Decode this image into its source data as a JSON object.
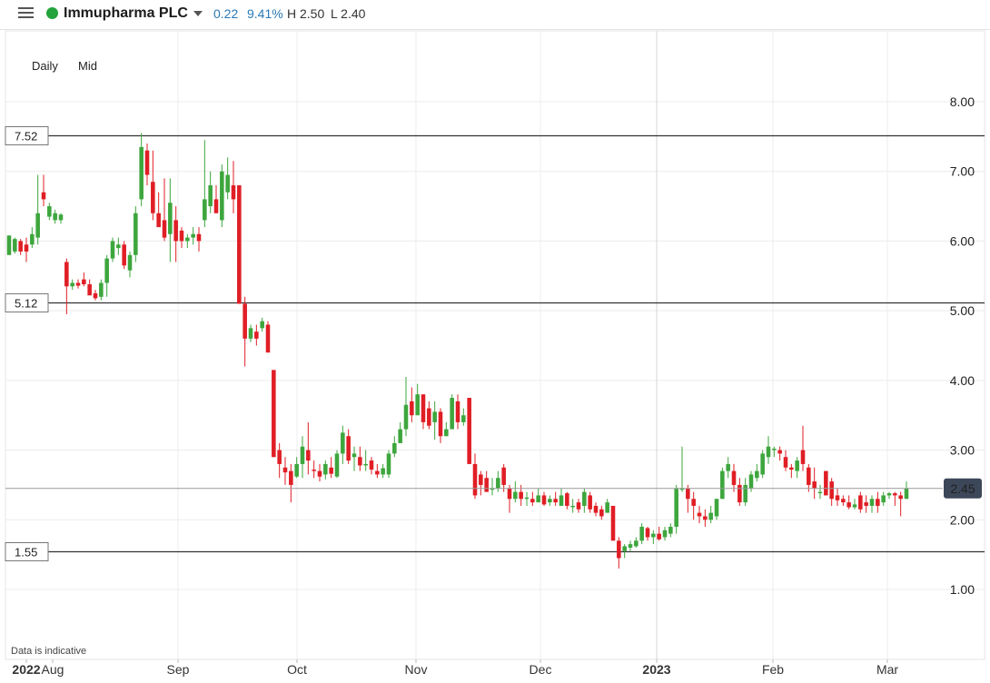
{
  "header": {
    "instrument": "Immupharma PLC",
    "change": "0.22",
    "change_pct": "9.41%",
    "high": "H 2.50",
    "low": "L 2.40",
    "status_color": "#22a33b"
  },
  "controls": {
    "interval": "Daily",
    "price_type": "Mid"
  },
  "note": "Data is indicative",
  "colors": {
    "up": "#3da63d",
    "down": "#e01e25",
    "grid": "#ececec",
    "line": "#333333"
  },
  "chart_data": {
    "type": "candlestick",
    "ylim": [
      0.5,
      8.5
    ],
    "y_ticks": [
      "8.00",
      "7.00",
      "6.00",
      "5.00",
      "4.00",
      "3.00",
      "2.00",
      "1.00"
    ],
    "x_ticks": [
      "2022",
      "Aug",
      "Sep",
      "Oct",
      "Nov",
      "Dec",
      "2023",
      "Feb",
      "Mar"
    ],
    "current_price": "2.45",
    "horizontal_lines": [
      {
        "value": 7.52,
        "label": "7.52"
      },
      {
        "value": 5.12,
        "label": "5.12"
      },
      {
        "value": 1.55,
        "label": "1.55"
      }
    ],
    "candles": [
      [
        6.08,
        5.8,
        5.8,
        6.08
      ],
      [
        6.05,
        5.82,
        5.85,
        6.03
      ],
      [
        6.03,
        5.8,
        6.0,
        5.85
      ],
      [
        6.05,
        5.7,
        5.95,
        5.85
      ],
      [
        6.2,
        5.9,
        5.95,
        6.1
      ],
      [
        6.95,
        5.95,
        6.05,
        6.4
      ],
      [
        6.95,
        6.5,
        6.7,
        6.6
      ],
      [
        6.55,
        6.3,
        6.35,
        6.5
      ],
      [
        6.45,
        6.25,
        6.3,
        6.4
      ],
      [
        6.4,
        6.25,
        6.3,
        6.38
      ],
      [
        5.75,
        4.95,
        5.7,
        5.35
      ],
      [
        5.45,
        5.3,
        5.35,
        5.4
      ],
      [
        5.45,
        5.32,
        5.4,
        5.36
      ],
      [
        5.55,
        5.35,
        5.45,
        5.38
      ],
      [
        5.45,
        5.25,
        5.38,
        5.22
      ],
      [
        5.3,
        5.15,
        5.25,
        5.18
      ],
      [
        5.45,
        5.15,
        5.2,
        5.4
      ],
      [
        5.8,
        5.2,
        5.4,
        5.75
      ],
      [
        6.05,
        5.7,
        5.75,
        6.0
      ],
      [
        6.05,
        5.8,
        5.9,
        5.95
      ],
      [
        6.0,
        5.6,
        5.95,
        5.65
      ],
      [
        5.85,
        5.48,
        5.58,
        5.8
      ],
      [
        6.5,
        5.7,
        5.8,
        6.4
      ],
      [
        7.55,
        6.5,
        6.6,
        7.35
      ],
      [
        7.4,
        6.8,
        7.3,
        6.95
      ],
      [
        7.3,
        6.3,
        6.85,
        6.4
      ],
      [
        6.7,
        6.2,
        6.4,
        6.2
      ],
      [
        6.9,
        6.0,
        6.3,
        6.05
      ],
      [
        6.9,
        5.7,
        6.1,
        6.55
      ],
      [
        6.5,
        5.7,
        6.3,
        6.0
      ],
      [
        6.2,
        5.9,
        6.15,
        6.0
      ],
      [
        6.1,
        5.9,
        6.0,
        6.05
      ],
      [
        6.2,
        5.95,
        6.05,
        6.1
      ],
      [
        6.2,
        5.85,
        6.1,
        6.0
      ],
      [
        7.45,
        6.2,
        6.3,
        6.6
      ],
      [
        7.0,
        6.4,
        6.5,
        6.8
      ],
      [
        6.8,
        6.4,
        6.6,
        6.4
      ],
      [
        7.1,
        6.2,
        6.3,
        7.0
      ],
      [
        7.2,
        6.6,
        6.7,
        6.95
      ],
      [
        7.15,
        6.4,
        6.8,
        6.6
      ],
      [
        6.8,
        5.1,
        6.8,
        5.1
      ],
      [
        5.2,
        4.2,
        5.1,
        4.6
      ],
      [
        4.8,
        4.55,
        4.6,
        4.75
      ],
      [
        4.8,
        4.5,
        4.7,
        4.6
      ],
      [
        4.9,
        4.7,
        4.75,
        4.85
      ],
      [
        4.85,
        4.4,
        4.8,
        4.4
      ],
      [
        4.15,
        2.9,
        4.15,
        2.9
      ],
      [
        3.1,
        2.6,
        3.0,
        2.8
      ],
      [
        2.9,
        2.5,
        2.75,
        2.68
      ],
      [
        2.8,
        2.25,
        2.7,
        2.5
      ],
      [
        2.9,
        2.6,
        2.62,
        2.8
      ],
      [
        3.2,
        2.6,
        2.8,
        3.05
      ],
      [
        3.4,
        2.65,
        3.0,
        2.85
      ],
      [
        2.85,
        2.6,
        2.72,
        2.7
      ],
      [
        2.8,
        2.55,
        2.7,
        2.62
      ],
      [
        2.85,
        2.58,
        2.65,
        2.8
      ],
      [
        2.9,
        2.6,
        2.75,
        2.66
      ],
      [
        3.0,
        2.6,
        2.62,
        2.95
      ],
      [
        3.35,
        2.8,
        2.95,
        3.25
      ],
      [
        3.3,
        2.8,
        3.2,
        2.85
      ],
      [
        3.05,
        2.7,
        2.9,
        2.95
      ],
      [
        3.05,
        2.7,
        2.9,
        2.78
      ],
      [
        3.0,
        2.7,
        2.78,
        2.8
      ],
      [
        2.9,
        2.65,
        2.85,
        2.72
      ],
      [
        2.8,
        2.6,
        2.7,
        2.65
      ],
      [
        2.8,
        2.6,
        2.65,
        2.74
      ],
      [
        3.0,
        2.6,
        2.65,
        2.95
      ],
      [
        3.2,
        2.9,
        2.95,
        3.1
      ],
      [
        3.4,
        3.1,
        3.1,
        3.3
      ],
      [
        4.05,
        3.2,
        3.3,
        3.65
      ],
      [
        3.9,
        3.4,
        3.7,
        3.5
      ],
      [
        3.95,
        3.5,
        3.5,
        3.8
      ],
      [
        3.8,
        3.3,
        3.8,
        3.4
      ],
      [
        3.7,
        3.3,
        3.6,
        3.35
      ],
      [
        3.7,
        3.15,
        3.4,
        3.55
      ],
      [
        3.6,
        3.1,
        3.55,
        3.2
      ],
      [
        3.4,
        3.2,
        3.2,
        3.3
      ],
      [
        3.8,
        3.3,
        3.3,
        3.75
      ],
      [
        3.8,
        3.3,
        3.7,
        3.4
      ],
      [
        3.6,
        3.35,
        3.4,
        3.5
      ],
      [
        3.75,
        2.8,
        3.75,
        2.8
      ],
      [
        2.95,
        2.3,
        2.8,
        2.35
      ],
      [
        2.7,
        2.35,
        2.65,
        2.5
      ],
      [
        2.7,
        2.4,
        2.6,
        2.4
      ],
      [
        2.6,
        2.35,
        2.45,
        2.45
      ],
      [
        2.7,
        2.4,
        2.45,
        2.6
      ],
      [
        2.8,
        2.4,
        2.75,
        2.5
      ],
      [
        2.5,
        2.1,
        2.45,
        2.3
      ],
      [
        2.55,
        2.25,
        2.3,
        2.4
      ],
      [
        2.5,
        2.2,
        2.4,
        2.3
      ],
      [
        2.4,
        2.2,
        2.3,
        2.32
      ],
      [
        2.4,
        2.2,
        2.3,
        2.25
      ],
      [
        2.45,
        2.25,
        2.25,
        2.35
      ],
      [
        2.4,
        2.2,
        2.35,
        2.22
      ],
      [
        2.35,
        2.2,
        2.25,
        2.3
      ],
      [
        2.4,
        2.2,
        2.3,
        2.25
      ],
      [
        2.45,
        2.2,
        2.2,
        2.35
      ],
      [
        2.4,
        2.15,
        2.38,
        2.2
      ],
      [
        2.3,
        2.1,
        2.2,
        2.2
      ],
      [
        2.3,
        2.1,
        2.25,
        2.15
      ],
      [
        2.45,
        2.1,
        2.2,
        2.4
      ],
      [
        2.4,
        2.1,
        2.35,
        2.15
      ],
      [
        2.25,
        2.05,
        2.2,
        2.1
      ],
      [
        2.2,
        2.0,
        2.15,
        2.05
      ],
      [
        2.3,
        2.1,
        2.1,
        2.25
      ],
      [
        2.2,
        1.7,
        2.2,
        1.7
      ],
      [
        1.75,
        1.3,
        1.7,
        1.45
      ],
      [
        1.65,
        1.45,
        1.55,
        1.62
      ],
      [
        1.7,
        1.55,
        1.6,
        1.65
      ],
      [
        1.75,
        1.6,
        1.62,
        1.7
      ],
      [
        1.95,
        1.65,
        1.7,
        1.9
      ],
      [
        1.9,
        1.7,
        1.88,
        1.75
      ],
      [
        1.85,
        1.65,
        1.75,
        1.8
      ],
      [
        1.9,
        1.7,
        1.8,
        1.72
      ],
      [
        1.9,
        1.7,
        1.75,
        1.85
      ],
      [
        1.95,
        1.75,
        1.8,
        1.9
      ],
      [
        2.5,
        1.8,
        1.9,
        2.45
      ],
      [
        3.05,
        2.4,
        2.45,
        2.45
      ],
      [
        2.5,
        2.1,
        2.45,
        2.3
      ],
      [
        2.4,
        2.0,
        2.3,
        2.2
      ],
      [
        2.2,
        1.95,
        2.1,
        2.05
      ],
      [
        2.15,
        1.9,
        2.05,
        2.0
      ],
      [
        2.2,
        1.95,
        2.0,
        2.1
      ],
      [
        2.3,
        2.0,
        2.05,
        2.3
      ],
      [
        2.75,
        2.3,
        2.3,
        2.7
      ],
      [
        2.9,
        2.6,
        2.7,
        2.8
      ],
      [
        2.8,
        2.4,
        2.7,
        2.5
      ],
      [
        2.6,
        2.2,
        2.5,
        2.25
      ],
      [
        2.6,
        2.2,
        2.25,
        2.5
      ],
      [
        2.7,
        2.4,
        2.45,
        2.65
      ],
      [
        2.8,
        2.55,
        2.6,
        2.7
      ],
      [
        3.0,
        2.6,
        2.65,
        2.95
      ],
      [
        3.2,
        2.8,
        2.9,
        3.05
      ],
      [
        3.05,
        2.9,
        3.0,
        3.02
      ],
      [
        3.05,
        2.85,
        3.0,
        2.95
      ],
      [
        3.0,
        2.7,
        2.9,
        2.75
      ],
      [
        2.8,
        2.6,
        2.75,
        2.72
      ],
      [
        2.9,
        2.6,
        2.7,
        2.85
      ],
      [
        3.35,
        2.7,
        3.0,
        2.8
      ],
      [
        2.8,
        2.4,
        2.75,
        2.5
      ],
      [
        2.75,
        2.3,
        2.55,
        2.45
      ],
      [
        2.5,
        2.3,
        2.4,
        2.4
      ],
      [
        2.7,
        2.35,
        2.7,
        2.35
      ],
      [
        2.6,
        2.2,
        2.55,
        2.3
      ],
      [
        2.45,
        2.2,
        2.35,
        2.28
      ],
      [
        2.35,
        2.2,
        2.3,
        2.25
      ],
      [
        2.35,
        2.15,
        2.25,
        2.18
      ],
      [
        2.3,
        2.15,
        2.18,
        2.22
      ],
      [
        2.4,
        2.1,
        2.35,
        2.15
      ],
      [
        2.35,
        2.1,
        2.25,
        2.2
      ],
      [
        2.35,
        2.1,
        2.2,
        2.3
      ],
      [
        2.4,
        2.1,
        2.3,
        2.2
      ],
      [
        2.4,
        2.2,
        2.25,
        2.35
      ],
      [
        2.4,
        2.3,
        2.35,
        2.38
      ],
      [
        2.4,
        2.2,
        2.38,
        2.35
      ],
      [
        2.4,
        2.05,
        2.35,
        2.3
      ],
      [
        2.55,
        2.3,
        2.3,
        2.45
      ]
    ]
  }
}
